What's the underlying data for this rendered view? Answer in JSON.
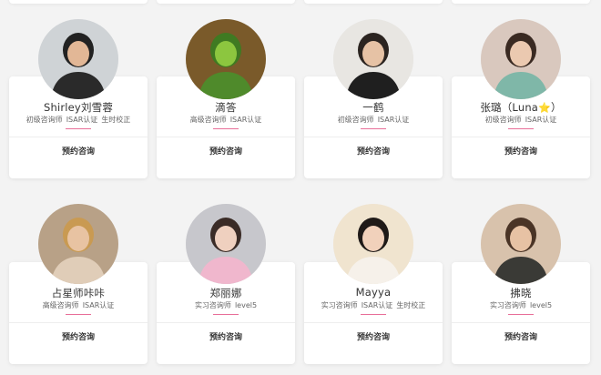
{
  "counselors": [
    {
      "name": "Shirley刘雪蓉",
      "star": "",
      "tags": [
        "初级咨询师",
        "ISAR认证",
        "生时校正"
      ],
      "action": "预约咨询",
      "avatar_bg": "#cfd3d6",
      "avatar_skin": "#e2b796",
      "avatar_cloth": "#2a2a2a",
      "avatar_hair": "#222222"
    },
    {
      "name": "滴答",
      "star": "",
      "tags": [
        "高级咨询师",
        "ISAR认证"
      ],
      "action": "预约咨询",
      "avatar_bg": "#7a5a2a",
      "avatar_skin": "#8cc63f",
      "avatar_cloth": "#4f8a2b",
      "avatar_hair": "#3f7a22"
    },
    {
      "name": "一鹤",
      "star": "",
      "tags": [
        "初级咨询师",
        "ISAR认证"
      ],
      "action": "预约咨询",
      "avatar_bg": "#e8e6e2",
      "avatar_skin": "#e6c2a5",
      "avatar_cloth": "#1f1f1f",
      "avatar_hair": "#2b2420"
    },
    {
      "name": "张璐（Luna",
      "star": "⭐",
      "name_end": "）",
      "tags": [
        "初级咨询师",
        "ISAR认证"
      ],
      "action": "预约咨询",
      "avatar_bg": "#d9c8be",
      "avatar_skin": "#ebc9b0",
      "avatar_cloth": "#7fb7a8",
      "avatar_hair": "#3a2a22"
    },
    {
      "name": "占星师咔咔",
      "star": "",
      "tags": [
        "高级咨询师",
        "ISAR认证"
      ],
      "action": "预约咨询",
      "avatar_bg": "#b8a187",
      "avatar_skin": "#e8c3a2",
      "avatar_cloth": "#e0cdb8",
      "avatar_hair": "#c99a52"
    },
    {
      "name": "郑丽娜",
      "star": "",
      "tags": [
        "实习咨询师",
        "level5"
      ],
      "action": "预约咨询",
      "avatar_bg": "#c7c7cc",
      "avatar_skin": "#efd0bf",
      "avatar_cloth": "#f0b7cd",
      "avatar_hair": "#3a2b26"
    },
    {
      "name": "Mayya",
      "star": "",
      "tags": [
        "实习咨询师",
        "ISAR认证",
        "生时校正"
      ],
      "action": "预约咨询",
      "avatar_bg": "#f0e4cf",
      "avatar_skin": "#f1d1bb",
      "avatar_cloth": "#f6f1ea",
      "avatar_hair": "#1f1a18"
    },
    {
      "name": "拂晓",
      "star": "",
      "tags": [
        "实习咨询师",
        "level5"
      ],
      "action": "预约咨询",
      "avatar_bg": "#d8c2ac",
      "avatar_skin": "#e7c2a4",
      "avatar_cloth": "#3a3a36",
      "avatar_hair": "#4a3426"
    }
  ],
  "colors": {
    "accent": "#e86f99",
    "background": "#f3f3f3",
    "card": "#ffffff"
  }
}
